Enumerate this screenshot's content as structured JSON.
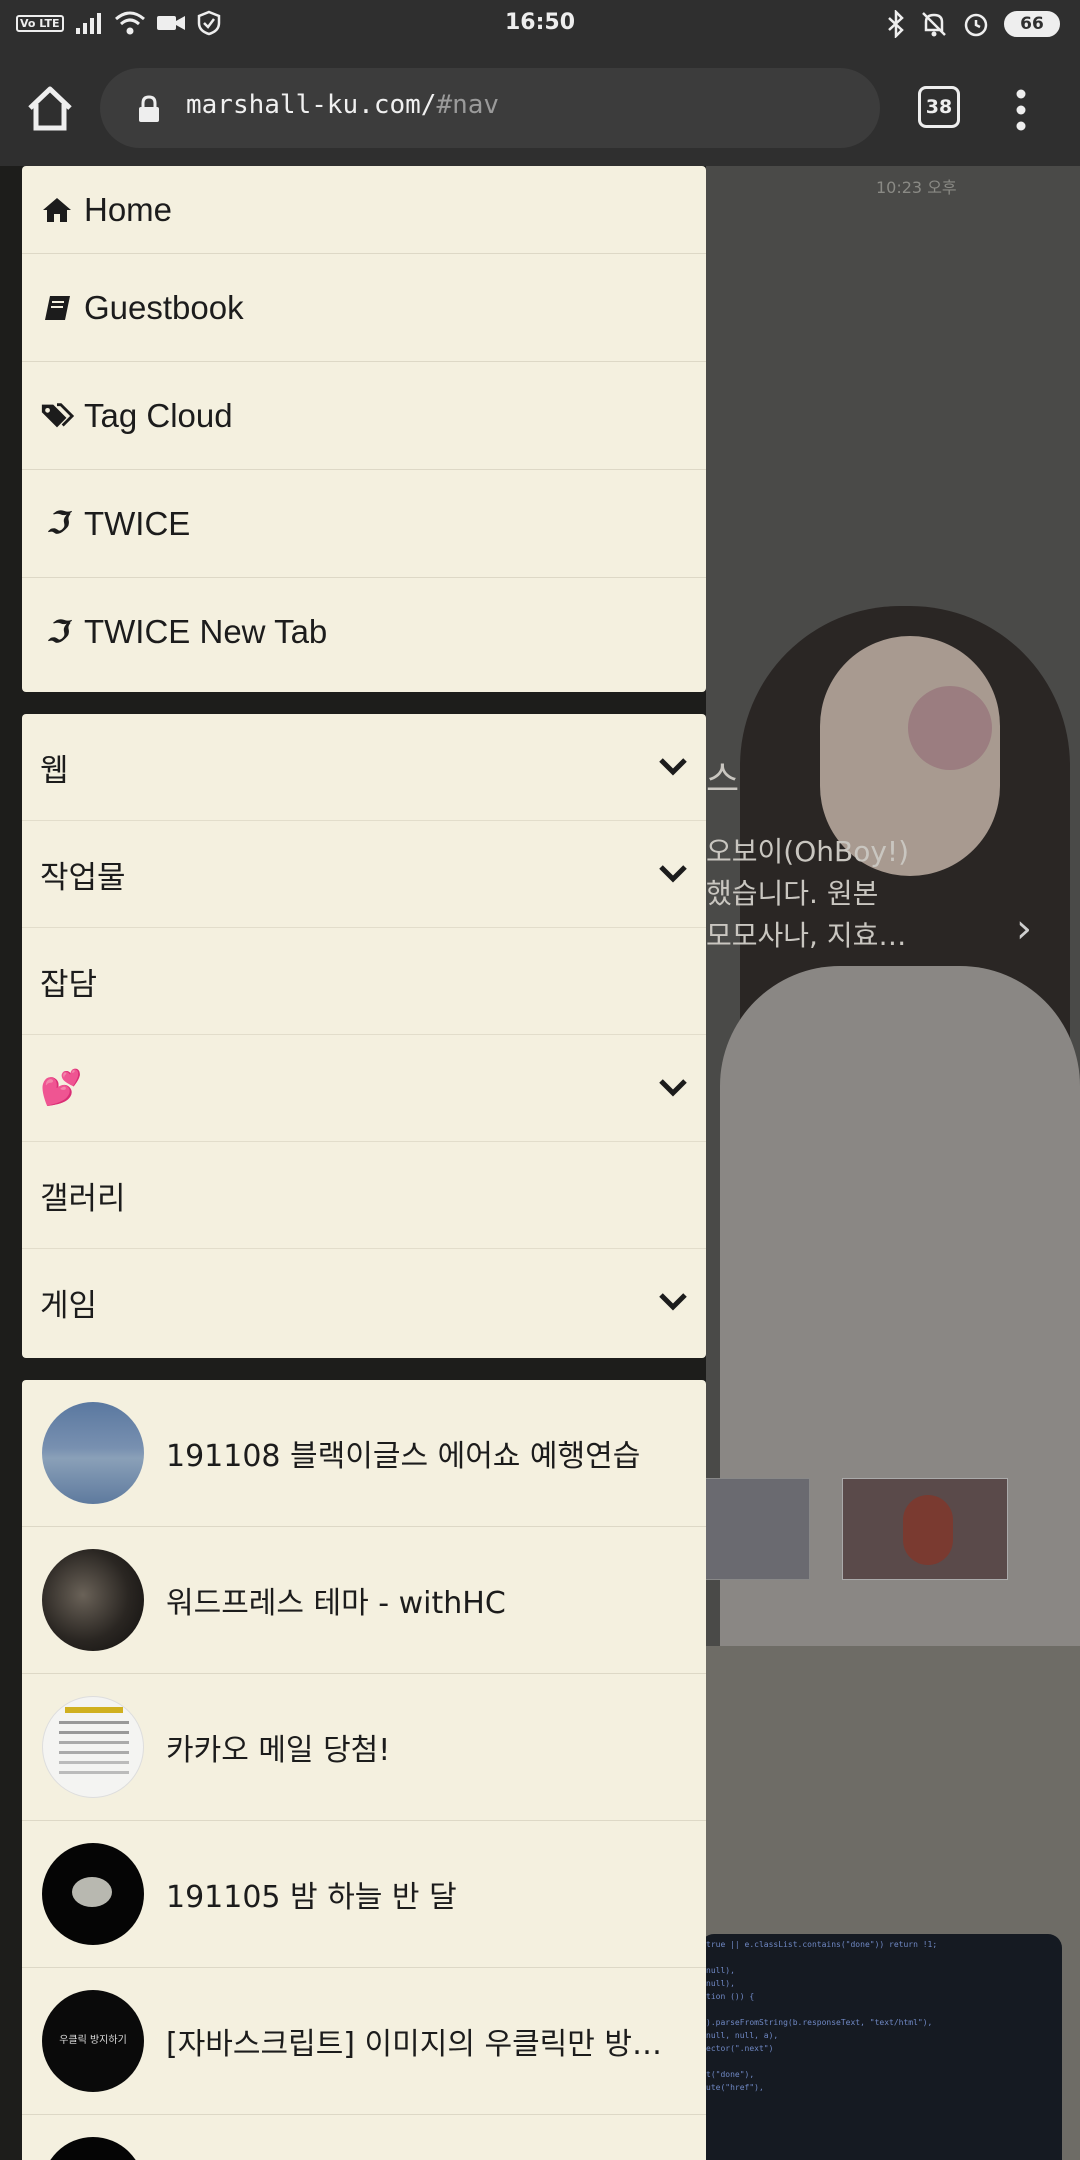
{
  "status_bar": {
    "time": "16:50",
    "volte_label": "Vo LTE",
    "battery": "66"
  },
  "browser": {
    "url_host": "marshall-ku.com/",
    "url_hash": "#nav",
    "tab_count": "38"
  },
  "background_page": {
    "time_label": "10:23 오후",
    "hero_line1": "스",
    "hero_line2": "오보이(OhBoy!)",
    "hero_line3": "했습니다. 원본",
    "hero_line4": "모모사나, 지효…"
  },
  "nav": {
    "main_links": [
      {
        "label": "Home",
        "icon": "home-icon"
      },
      {
        "label": "Guestbook",
        "icon": "book-icon"
      },
      {
        "label": "Tag Cloud",
        "icon": "tags-icon"
      },
      {
        "label": "TWICE",
        "icon": "twice-logo-icon"
      },
      {
        "label": "TWICE New Tab",
        "icon": "twice-logo-icon"
      }
    ],
    "categories": [
      {
        "label": "웹",
        "expandable": true
      },
      {
        "label": "작업물",
        "expandable": true
      },
      {
        "label": "잡담",
        "expandable": false
      },
      {
        "label": "💕",
        "expandable": true
      },
      {
        "label": "갤러리",
        "expandable": false
      },
      {
        "label": "게임",
        "expandable": true
      }
    ],
    "recent_posts": [
      {
        "title": "191108 블랙이글스 에어쇼 예행연습"
      },
      {
        "title": "워드프레스 테마 - withHC"
      },
      {
        "title": "카카오 메일 당첨!"
      },
      {
        "title": "191105 밤 하늘 반 달"
      },
      {
        "title": "[자바스크립트] 이미지의 우클릭만 방지하기"
      },
      {
        "title": ""
      }
    ],
    "post_thumb_texts": {
      "kakao_header": "메일주소",
      "js_thumb": "우클릭 방지하기"
    }
  },
  "colors": {
    "drawer_card": "#f4f0df",
    "status_bar": "#2f2f2f",
    "heart": "#d93a3a"
  }
}
